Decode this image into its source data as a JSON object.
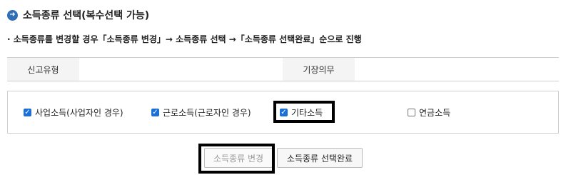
{
  "section": {
    "icon": "arrow-right-circle-icon",
    "title": "소득종류 선택(복수선택 가능)"
  },
  "notice": "· 소득종류를 변경할 경우「소득종류 변경」→ 소득종류 선택 →「소득종류 선택완료」순으로 진행",
  "info_table": {
    "report_type_label": "신고유형",
    "report_type_value": "",
    "bookkeeping_label": "기장의무",
    "bookkeeping_value": ""
  },
  "income_options": [
    {
      "label": "사업소득(사업자인 경우)",
      "checked": true
    },
    {
      "label": "근로소득(근로자인 경우)",
      "checked": true
    },
    {
      "label": "기타소득",
      "checked": true
    },
    {
      "label": "연금소득",
      "checked": false
    }
  ],
  "buttons": {
    "change_label": "소득종류 변경",
    "complete_label": "소득종류 선택완료"
  },
  "colors": {
    "accent": "#1a6fd8",
    "title_icon": "#2f6db5",
    "highlight": "#000000"
  }
}
